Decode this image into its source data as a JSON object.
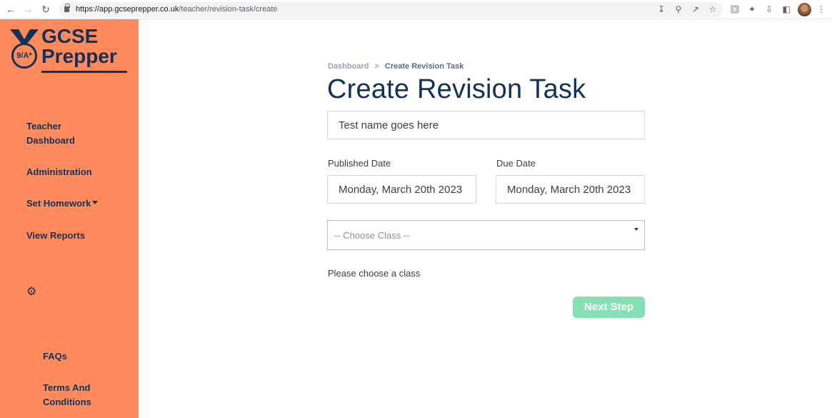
{
  "browser": {
    "url_host": "https://app.gcseprepper.co.uk",
    "url_path": "/teacher/revision-task/create",
    "back_icon": "arrow-left-icon",
    "forward_icon": "arrow-right-icon",
    "reload_icon": "reload-icon"
  },
  "logo": {
    "line1": "GCSE",
    "line2": "Prepper",
    "medal_text": "9/A*"
  },
  "sidebar": {
    "items": [
      {
        "label_line1": "Teacher",
        "label_line2": "Dashboard"
      },
      {
        "label": "Administration"
      },
      {
        "label": "Set Homework"
      },
      {
        "label": "View Reports"
      }
    ],
    "settings_icon": "gear-icon",
    "footer": [
      {
        "label": "FAQs"
      },
      {
        "label_line1": "Terms And",
        "label_line2": "Conditions"
      }
    ]
  },
  "breadcrumb": {
    "root": "Dashboard",
    "separator": ">",
    "current": "Create Revision Task"
  },
  "page": {
    "title": "Create Revision Task"
  },
  "form": {
    "test_name": "Test name goes here",
    "published_label": "Published Date",
    "published_value": "Monday, March 20th 2023",
    "due_label": "Due Date",
    "due_value": "Monday, March 20th 2023",
    "class_select": "-- Choose Class --",
    "hint": "Please choose a class",
    "next_label": "Next Step"
  },
  "colors": {
    "sidebar_bg": "#ff8a5b",
    "brand_navy": "#143257",
    "next_button": "#86e0b4"
  }
}
